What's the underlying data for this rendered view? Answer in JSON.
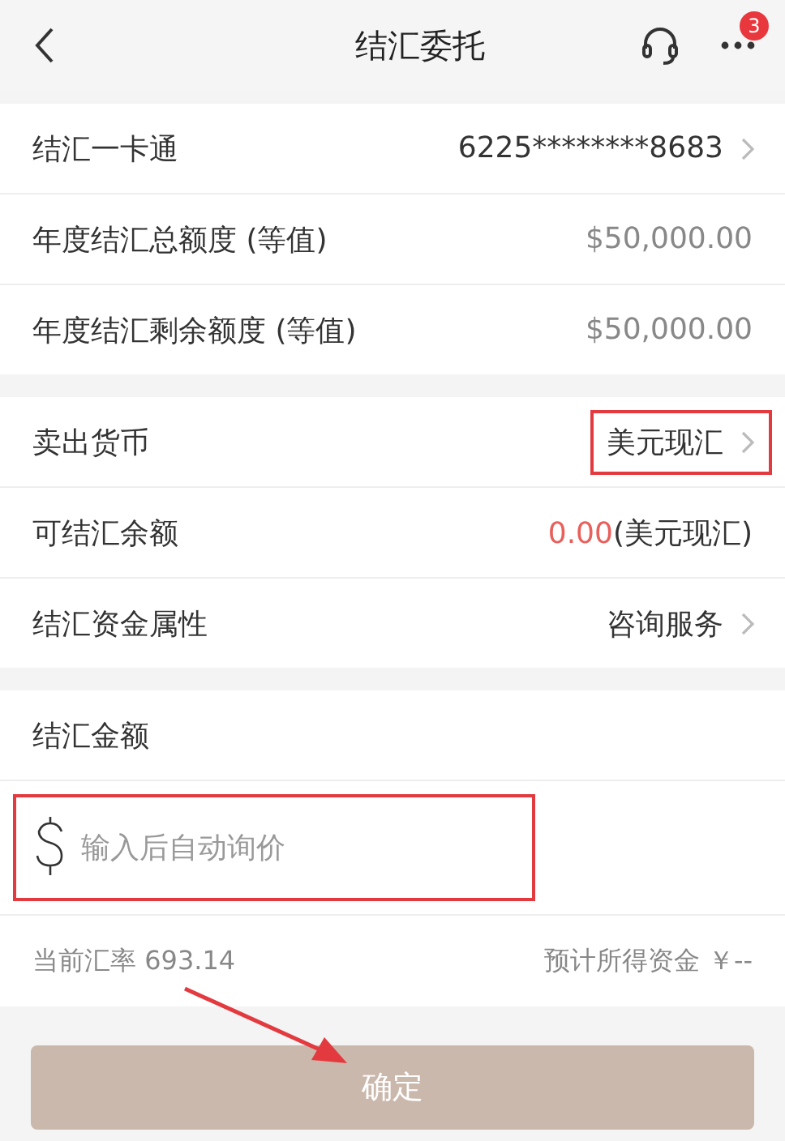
{
  "header": {
    "title": "结汇委托",
    "badge": "3"
  },
  "sections": [
    {
      "rows": [
        {
          "kind": "link",
          "label": "结汇一卡通",
          "value": "6225********8683",
          "highlighted": false
        },
        {
          "kind": "info",
          "label": "年度结汇总额度 (等值)",
          "value": "$50,000.00"
        },
        {
          "kind": "info",
          "label": "年度结汇剩余额度 (等值)",
          "value": "$50,000.00"
        }
      ]
    },
    {
      "rows": [
        {
          "kind": "link",
          "label": "卖出货币",
          "value": "美元现汇",
          "highlighted": true
        },
        {
          "kind": "balance",
          "label": "可结汇余额",
          "amount": "0.00",
          "unit": "(美元现汇)"
        },
        {
          "kind": "link",
          "label": "结汇资金属性",
          "value": "咨询服务",
          "highlighted": false
        }
      ]
    }
  ],
  "amount": {
    "label": "结汇金额",
    "placeholder": "输入后自动询价",
    "highlighted": true,
    "rate": "当前汇率 693.14",
    "estimate": "预计所得资金 ￥--"
  },
  "confirm": {
    "label": "确定",
    "disabled": true
  },
  "annotation_arrow": true
}
